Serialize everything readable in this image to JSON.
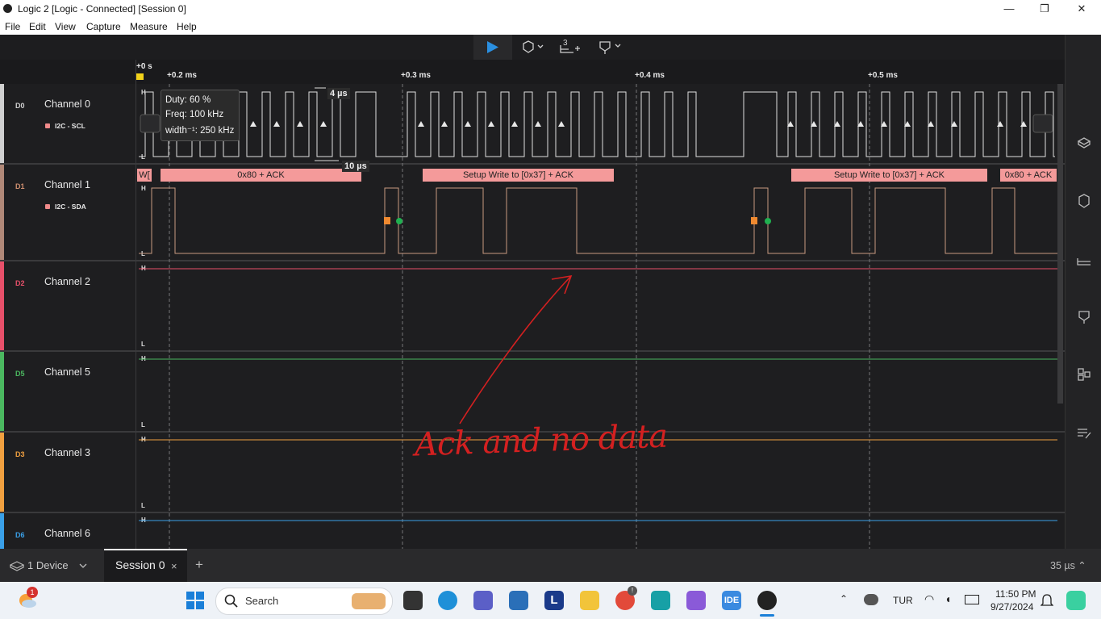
{
  "window": {
    "title": "Logic 2 [Logic - Connected] [Session 0]",
    "minimize": "—",
    "restore": "❐",
    "close": "✕"
  },
  "menu": [
    "File",
    "Edit",
    "View",
    "Capture",
    "Measure",
    "Help"
  ],
  "toolbar": {
    "timing_marker_label": "3"
  },
  "ruler": {
    "origin": "+0 s",
    "ticks": [
      "+0.2 ms",
      "+0.3 ms",
      "+0.4 ms",
      "+0.5 ms"
    ]
  },
  "tooltip": {
    "duty": "Duty: 60 %",
    "freq": "Freq: 100 kHz",
    "width": "width⁻¹: 250 kHz"
  },
  "markers": {
    "pulse_width": "4 µs",
    "period": "10 µs"
  },
  "channels": [
    {
      "id": "D0",
      "name": "Channel 0",
      "protocol": "I2C - SCL",
      "color": "#d0d0d0"
    },
    {
      "id": "D1",
      "name": "Channel 1",
      "protocol": "I2C - SDA",
      "color": "#b08878"
    },
    {
      "id": "D2",
      "name": "Channel 2",
      "color": "#e8506a"
    },
    {
      "id": "D5",
      "name": "Channel 5",
      "color": "#4bb860"
    },
    {
      "id": "D3",
      "name": "Channel 3",
      "color": "#f0a040"
    },
    {
      "id": "D6",
      "name": "Channel 6",
      "color": "#3aa0e8"
    }
  ],
  "hl": {
    "high": "H",
    "low": "L"
  },
  "decode": [
    "W[",
    "0x80 + ACK",
    "Setup Write to [0x37] + ACK",
    "Setup Write to [0x37] + ACK",
    "0x80 + ACK"
  ],
  "annotation": {
    "text": "Ack and no data",
    "color": "#d42020"
  },
  "bottom": {
    "device": "1 Device",
    "session": "Session 0",
    "close": "×",
    "add": "+",
    "timespan": "35 µs ⌃"
  },
  "taskbar": {
    "search": "Search",
    "notify_count": "1",
    "lang": "TUR",
    "time": "11:50 PM",
    "date": "9/27/2024",
    "l_label": "L",
    "ide_label": "IDE",
    "chrome_badge": "!"
  },
  "colors": {
    "decode_bg": "#f49a9a",
    "sda_trace": "#c89a80",
    "scl_trace": "#e0e0e0",
    "ack_start": "#f08a30",
    "ack_stop": "#20b050"
  }
}
